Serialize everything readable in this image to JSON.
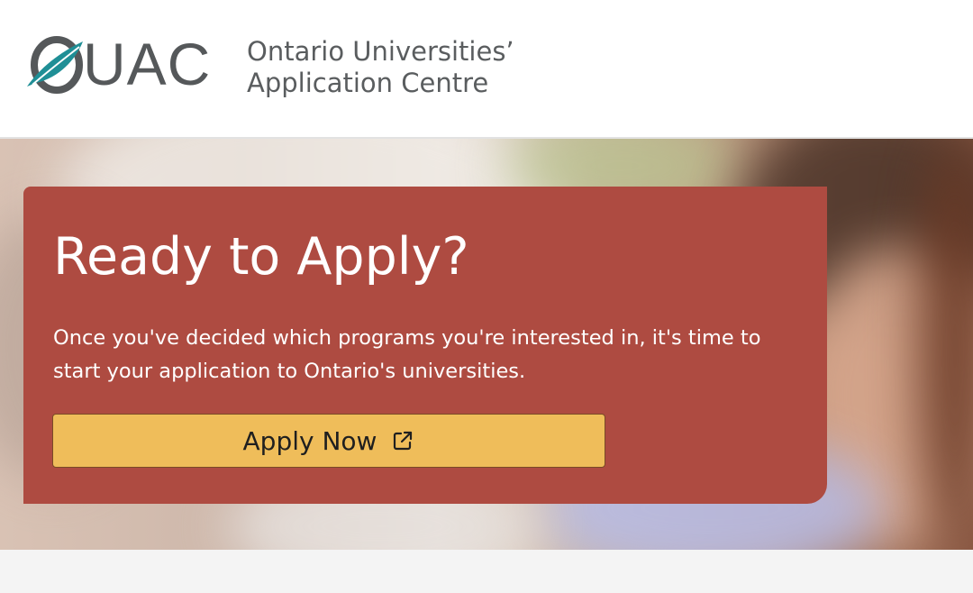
{
  "header": {
    "logo_letters": "UAC",
    "org_name_line1": "Ontario Universities’",
    "org_name_line2": "Application Centre"
  },
  "hero": {
    "title": "Ready to Apply?",
    "body": "Once you've decided which programs you're interested in, it's time to start your application to Ontario's universities.",
    "button_label": "Apply Now",
    "button_icon": "external-link-icon"
  },
  "colors": {
    "card_background": "#ae4b41",
    "button_background": "#efbd5a",
    "logo_teal": "#1f8f96",
    "logo_gray": "#55585a"
  }
}
